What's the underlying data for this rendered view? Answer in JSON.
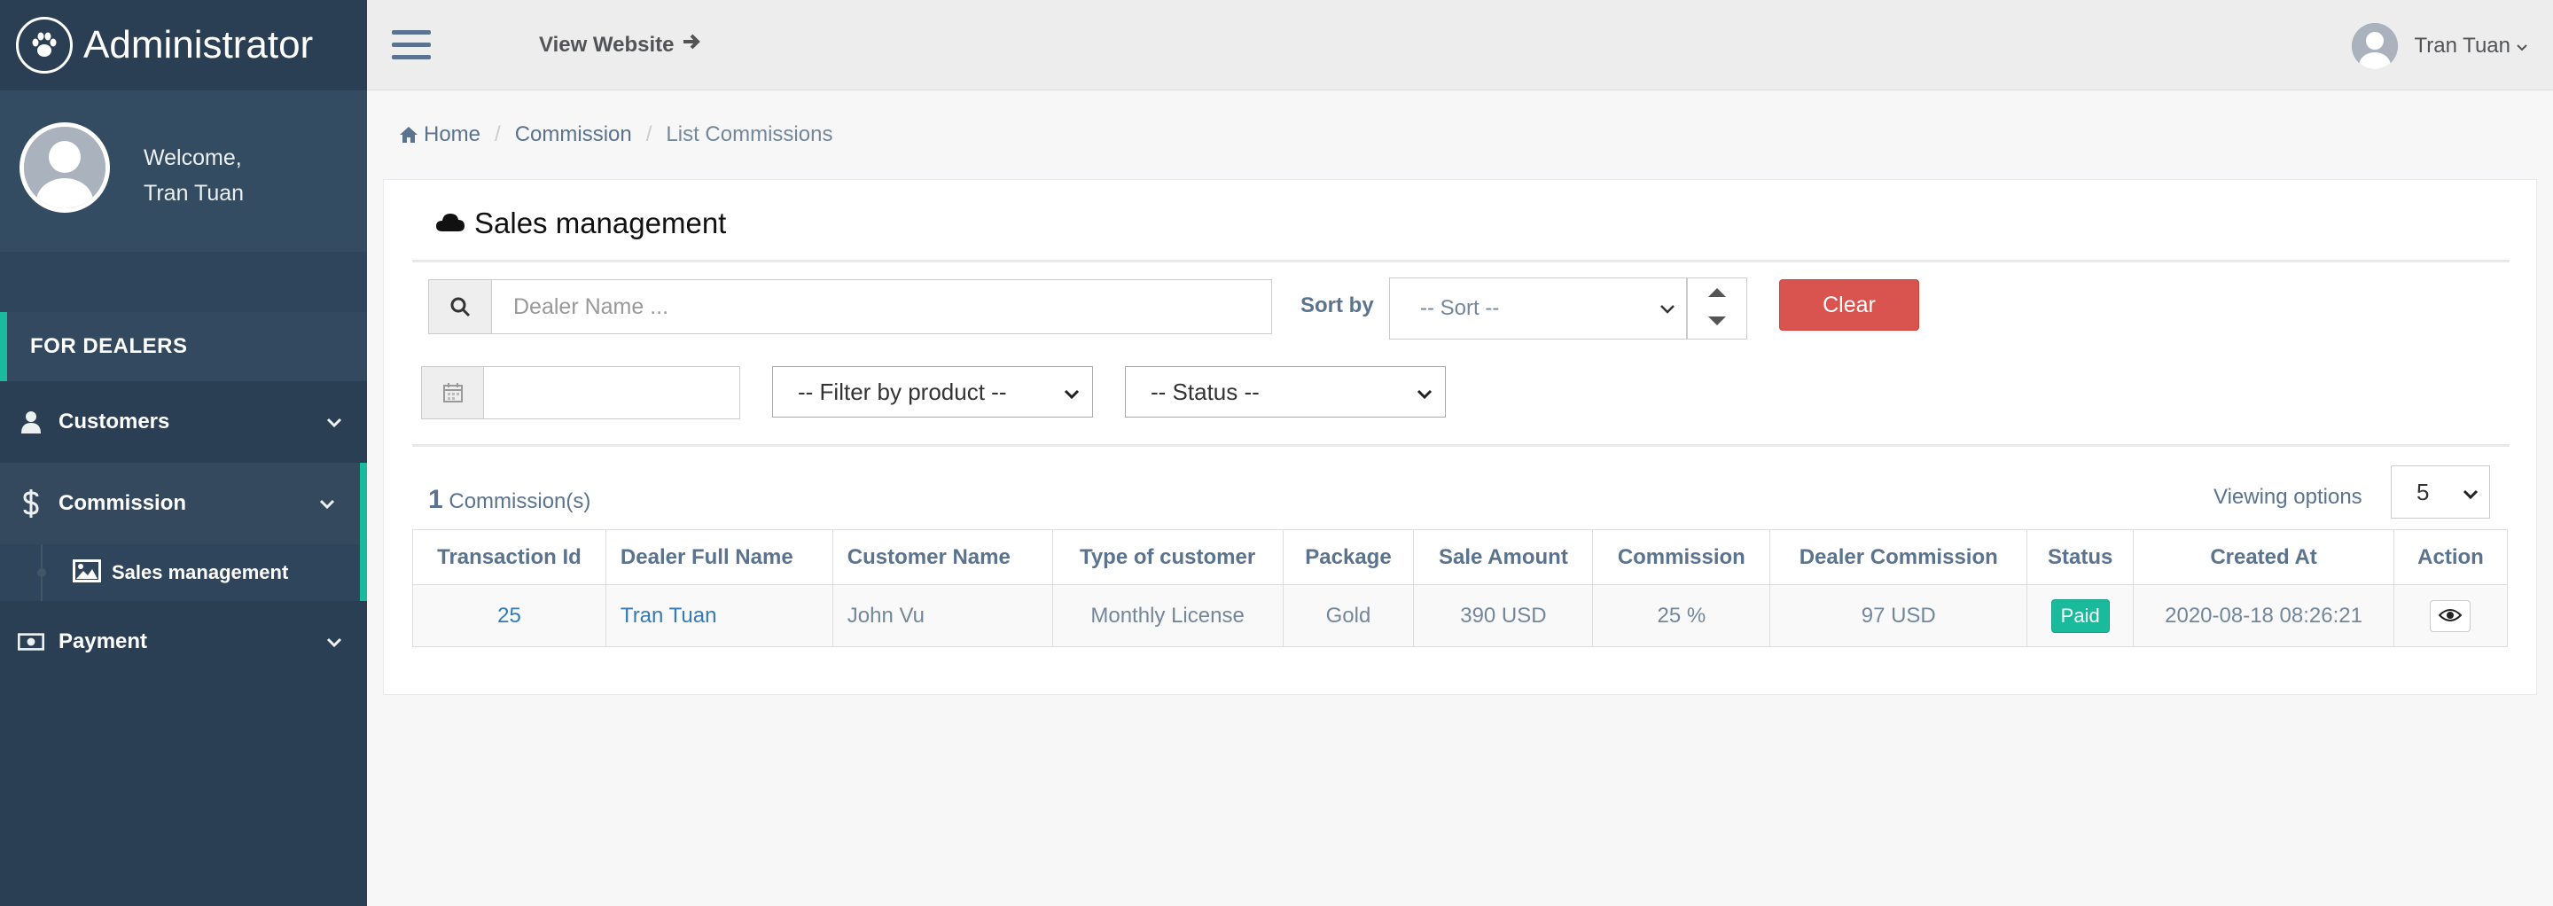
{
  "sidebar": {
    "brand": "Administrator",
    "welcome": "Welcome,",
    "user_name": "Tran Tuan",
    "section": "FOR DEALERS",
    "items": [
      {
        "label": "Customers",
        "icon": "user-icon"
      },
      {
        "label": "Commission",
        "icon": "dollar-icon"
      },
      {
        "label": "Payment",
        "icon": "money-icon"
      }
    ],
    "submenu": {
      "label": "Sales management",
      "icon": "image-icon"
    }
  },
  "topnav": {
    "view_website": "View Website",
    "user": "Tran Tuan"
  },
  "breadcrumb": {
    "home": "Home",
    "commission": "Commission",
    "current": "List Commissions"
  },
  "panel": {
    "title": "Sales management",
    "search_placeholder": "Dealer Name ...",
    "sort_label": "Sort by",
    "sort_value": "-- Sort --",
    "clear": "Clear",
    "filter_product": "-- Filter by product --",
    "filter_status": "-- Status --",
    "count": "1",
    "count_label": "Commission(s)",
    "viewing_label": "Viewing options",
    "viewing_value": "5"
  },
  "table": {
    "headers": [
      "Transaction Id",
      "Dealer Full Name",
      "Customer Name",
      "Type of customer",
      "Package",
      "Sale Amount",
      "Commission",
      "Dealer Commission",
      "Status",
      "Created At",
      "Action"
    ],
    "rows": [
      {
        "id": "25",
        "dealer": "Tran Tuan",
        "customer": "John Vu",
        "type": "Monthly License",
        "package": "Gold",
        "sale_amount": "390 USD",
        "commission": "25 %",
        "dealer_commission": "97 USD",
        "status": "Paid",
        "created_at": "2020-08-18 08:26:21"
      }
    ]
  },
  "colors": {
    "sidebar": "#2a3f54",
    "accent": "#1abb9c",
    "danger": "#d9534f",
    "link": "#337ab7"
  }
}
